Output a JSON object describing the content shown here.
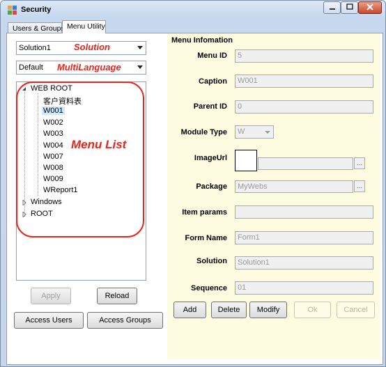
{
  "window": {
    "title": "Security"
  },
  "tabs": [
    {
      "label": "Users & Groups"
    },
    {
      "label": "Menu Utility"
    }
  ],
  "left": {
    "solution_combo": {
      "value": "Solution1"
    },
    "language_combo": {
      "value": "Default"
    },
    "annotations": {
      "solution": "Solution",
      "multilanguage": "MultiLanguage",
      "menu_list": "Menu List"
    },
    "tree": {
      "root": "WEB ROOT",
      "children": [
        "客户資料表",
        "W001",
        "W002",
        "W003",
        "W004",
        "W007",
        "W008",
        "W009",
        "WReport1"
      ],
      "selected": "W001",
      "siblings": [
        "Windows",
        "ROOT"
      ]
    },
    "buttons": {
      "apply": "Apply",
      "reload": "Reload",
      "access_users": "Access Users",
      "access_groups": "Access Groups"
    }
  },
  "menu_info": {
    "title": "Menu Infomation",
    "fields": {
      "menu_id": {
        "label": "Menu ID",
        "value": "5"
      },
      "caption": {
        "label": "Caption",
        "value": "W001"
      },
      "parent_id": {
        "label": "Parent ID",
        "value": "0"
      },
      "module_type": {
        "label": "Module Type",
        "value": "W"
      },
      "image_url": {
        "label": "ImageUrl",
        "value": ""
      },
      "package": {
        "label": "Package",
        "value": "MyWebs"
      },
      "item_params": {
        "label": "Item params",
        "value": ""
      },
      "form_name": {
        "label": "Form Name",
        "value": "Form1"
      },
      "solution": {
        "label": "Solution",
        "value": "Solution1"
      },
      "sequence": {
        "label": "Sequence",
        "value": "01"
      }
    },
    "buttons": {
      "add": "Add",
      "delete": "Delete",
      "modify": "Modify",
      "ok": "Ok",
      "cancel": "Cancel"
    }
  },
  "colors": {
    "annotation": "#e8241b",
    "info_panel_bg": "#fdfbe0",
    "selection": "#cfe6fb"
  }
}
